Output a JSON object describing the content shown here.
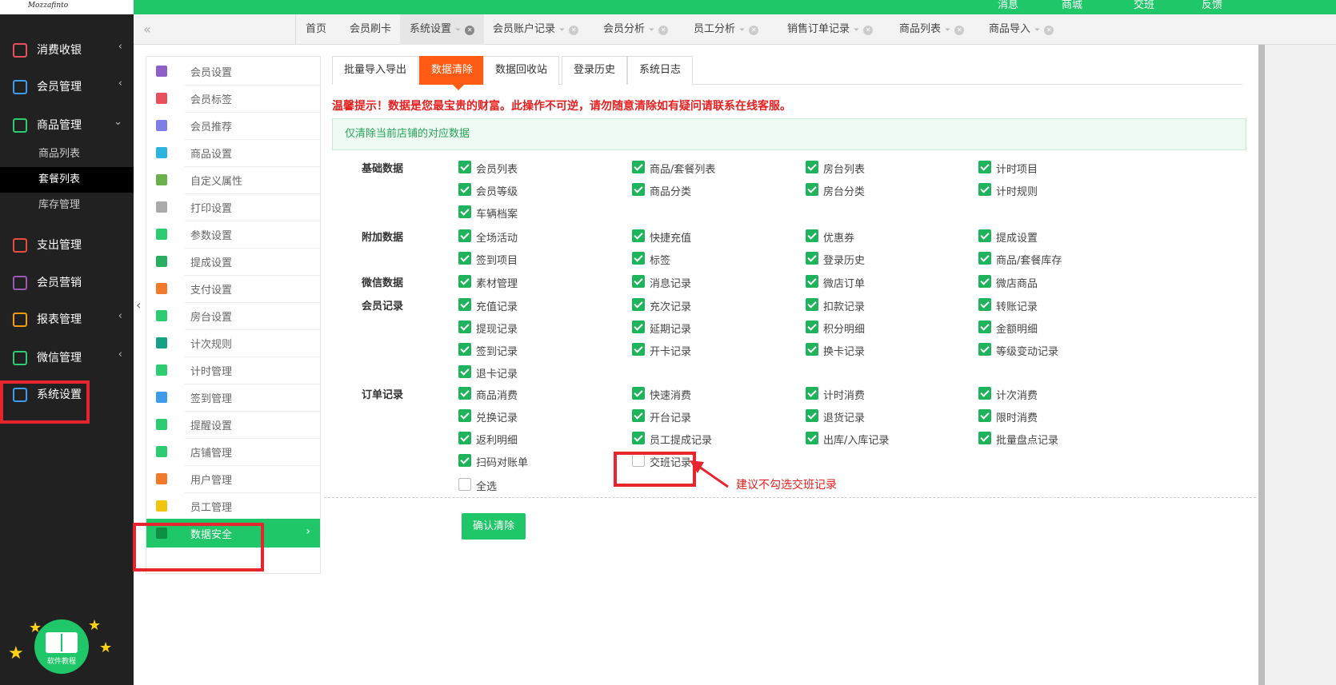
{
  "top": {
    "logo": "Mozzafinto",
    "links": [
      "消息",
      "商城",
      "交班",
      "反馈"
    ]
  },
  "sidebar": {
    "items": [
      {
        "label": "消费收银",
        "icon": "cashier-icon",
        "color": "#e8505b",
        "arrow": "‹"
      },
      {
        "label": "会员管理",
        "icon": "member-icon",
        "color": "#3d9be9",
        "arrow": "‹"
      },
      {
        "label": "商品管理",
        "icon": "goods-icon",
        "color": "#2ecc71",
        "arrow": "⌄"
      },
      {
        "label": "支出管理",
        "icon": "expense-icon",
        "color": "#e74c3c",
        "arrow": ""
      },
      {
        "label": "会员营销",
        "icon": "gift-icon",
        "color": "#9b59b6",
        "arrow": ""
      },
      {
        "label": "报表管理",
        "icon": "report-icon",
        "color": "#f39c12",
        "arrow": "‹"
      },
      {
        "label": "微信管理",
        "icon": "wechat-icon",
        "color": "#2ecc71",
        "arrow": "‹"
      },
      {
        "label": "系统设置",
        "icon": "gear-icon",
        "color": "#3d9be9",
        "arrow": ""
      }
    ],
    "sub": [
      "商品列表",
      "套餐列表",
      "库存管理"
    ],
    "tutorial": "软件教程"
  },
  "tabs": [
    "首页",
    "会员刷卡",
    "系统设置",
    "会员账户记录",
    "会员分析",
    "员工分析",
    "销售订单记录",
    "商品列表",
    "商品导入"
  ],
  "menu": [
    {
      "label": "会员设置",
      "color": "#8e5fc8"
    },
    {
      "label": "会员标签",
      "color": "#e8505b"
    },
    {
      "label": "会员推荐",
      "color": "#7d7de8"
    },
    {
      "label": "商品设置",
      "color": "#2bb4e0"
    },
    {
      "label": "自定义属性",
      "color": "#6ab04c"
    },
    {
      "label": "打印设置",
      "color": "#aaaaaa"
    },
    {
      "label": "参数设置",
      "color": "#2ecc71"
    },
    {
      "label": "提成设置",
      "color": "#27ae60"
    },
    {
      "label": "支付设置",
      "color": "#f07a2a"
    },
    {
      "label": "房台设置",
      "color": "#2ecc71"
    },
    {
      "label": "计次规则",
      "color": "#16a085"
    },
    {
      "label": "计时管理",
      "color": "#2ecc71"
    },
    {
      "label": "签到管理",
      "color": "#3d9be9"
    },
    {
      "label": "提醒设置",
      "color": "#2ecc71"
    },
    {
      "label": "店铺管理",
      "color": "#2ecc71"
    },
    {
      "label": "用户管理",
      "color": "#f07a2a"
    },
    {
      "label": "员工管理",
      "color": "#f1c40f"
    },
    {
      "label": "数据安全",
      "color": "#0f8f44"
    }
  ],
  "ctabs": [
    "批量导入导出",
    "数据清除",
    "数据回收站",
    "登录历史",
    "系统日志"
  ],
  "warning": "温馨提示！数据是您最宝贵的财富。此操作不可逆，请勿随意清除如有疑问请联系在线客服。",
  "notice": "仅清除当前店铺的对应数据",
  "categories": [
    "基础数据",
    "附加数据",
    "微信数据",
    "会员记录",
    "订单记录"
  ],
  "checkboxes": [
    {
      "label": "会员列表",
      "checked": true
    },
    {
      "label": "商品/套餐列表",
      "checked": true
    },
    {
      "label": "房台列表",
      "checked": true
    },
    {
      "label": "计时项目",
      "checked": true
    },
    {
      "label": "会员等级",
      "checked": true
    },
    {
      "label": "商品分类",
      "checked": true
    },
    {
      "label": "房台分类",
      "checked": true
    },
    {
      "label": "计时规则",
      "checked": true
    },
    {
      "label": "车辆档案",
      "checked": true
    },
    {
      "label": "全场活动",
      "checked": true
    },
    {
      "label": "快捷充值",
      "checked": true
    },
    {
      "label": "优惠券",
      "checked": true
    },
    {
      "label": "提成设置",
      "checked": true
    },
    {
      "label": "签到项目",
      "checked": true
    },
    {
      "label": "标签",
      "checked": true
    },
    {
      "label": "登录历史",
      "checked": true
    },
    {
      "label": "商品/套餐库存",
      "checked": true
    },
    {
      "label": "素材管理",
      "checked": true
    },
    {
      "label": "消息记录",
      "checked": true
    },
    {
      "label": "微店订单",
      "checked": true
    },
    {
      "label": "微店商品",
      "checked": true
    },
    {
      "label": "充值记录",
      "checked": true
    },
    {
      "label": "充次记录",
      "checked": true
    },
    {
      "label": "扣款记录",
      "checked": true
    },
    {
      "label": "转账记录",
      "checked": true
    },
    {
      "label": "提现记录",
      "checked": true
    },
    {
      "label": "延期记录",
      "checked": true
    },
    {
      "label": "积分明细",
      "checked": true
    },
    {
      "label": "金额明细",
      "checked": true
    },
    {
      "label": "签到记录",
      "checked": true
    },
    {
      "label": "开卡记录",
      "checked": true
    },
    {
      "label": "换卡记录",
      "checked": true
    },
    {
      "label": "等级变动记录",
      "checked": true
    },
    {
      "label": "退卡记录",
      "checked": true
    },
    {
      "label": "商品消费",
      "checked": true
    },
    {
      "label": "快速消费",
      "checked": true
    },
    {
      "label": "计时消费",
      "checked": true
    },
    {
      "label": "计次消费",
      "checked": true
    },
    {
      "label": "兑换记录",
      "checked": true
    },
    {
      "label": "开台记录",
      "checked": true
    },
    {
      "label": "退货记录",
      "checked": true
    },
    {
      "label": "限时消费",
      "checked": true
    },
    {
      "label": "返利明细",
      "checked": true
    },
    {
      "label": "员工提成记录",
      "checked": true
    },
    {
      "label": "出库/入库记录",
      "checked": true
    },
    {
      "label": "批量盘点记录",
      "checked": true
    },
    {
      "label": "扫码对账单",
      "checked": true
    },
    {
      "label": "交班记录",
      "checked": false
    },
    {
      "label": "全选",
      "checked": false
    }
  ],
  "confirm": "确认清除",
  "suggestion": "建议不勾选交班记录"
}
